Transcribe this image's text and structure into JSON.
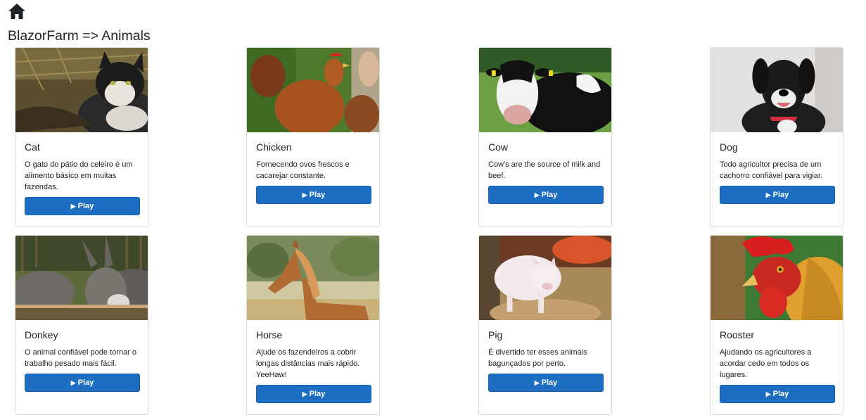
{
  "header": {
    "home_icon": "home-icon",
    "title": "BlazorFarm => Animals"
  },
  "animals": [
    {
      "name": "Cat",
      "description": "O gato do pátio do celeiro é um alimento básico em muitas fazendas.",
      "button": "Play",
      "button_icon": "play-icon"
    },
    {
      "name": "Chicken",
      "description": "Fornecendo ovos frescos e cacarejar constante.",
      "button": "Play",
      "button_icon": "play-icon"
    },
    {
      "name": "Cow",
      "description": "Cow's are the source of milk and beef.",
      "button": "Play",
      "button_icon": "play-icon"
    },
    {
      "name": "Dog",
      "description": "Todo agricultor precisa de um cachorro confiável para vigiar.",
      "button": "Play",
      "button_icon": "play-icon"
    },
    {
      "name": "Donkey",
      "description": "O animal confiável pode tornar o trabalho pesado mais fácil.",
      "button": "Play",
      "button_icon": "play-icon"
    },
    {
      "name": "Horse",
      "description": "Ajude os fazendeiros a cobrir longas distâncias mais rápido. YeeHaw!",
      "button": "Play",
      "button_icon": "play-icon"
    },
    {
      "name": "Pig",
      "description": "É divertido ter esses animais bagunçados por perto.",
      "button": "Play",
      "button_icon": "play-icon"
    },
    {
      "name": "Rooster",
      "description": "Ajudando os agricultores a acordar cedo em todos os lugares.",
      "button": "Play",
      "button_icon": "play-icon"
    }
  ],
  "colors": {
    "button": "#1b6ec2",
    "card_border": "#dcdcdc"
  }
}
